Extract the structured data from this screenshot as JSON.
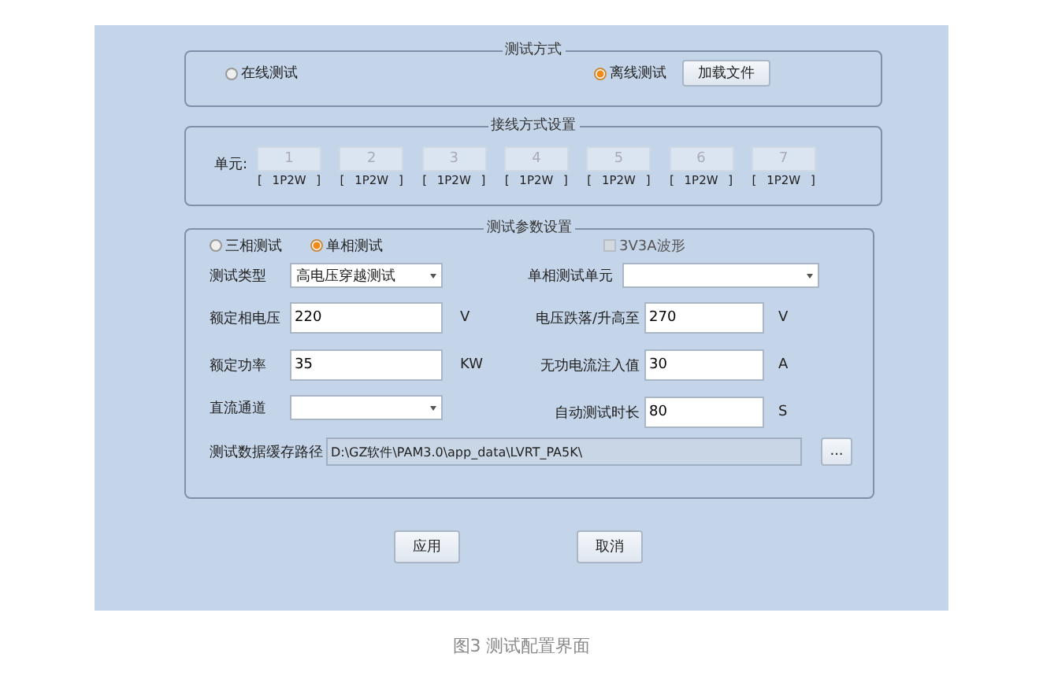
{
  "test_mode": {
    "title": "测试方式",
    "options": [
      {
        "label": "在线测试",
        "selected": false
      },
      {
        "label": "离线测试",
        "selected": true
      }
    ],
    "load_button": "加载文件"
  },
  "wiring": {
    "title": "接线方式设置",
    "label": "单元:",
    "units": [
      {
        "number": "1",
        "mode": "[ 1P2W ]",
        "disabled": true
      },
      {
        "number": "2",
        "mode": "[ 1P2W ]",
        "disabled": true
      },
      {
        "number": "3",
        "mode": "[ 1P2W ]",
        "disabled": true
      },
      {
        "number": "4",
        "mode": "[ 1P2W ]",
        "disabled": true
      },
      {
        "number": "5",
        "mode": "[ 1P2W ]",
        "disabled": true
      },
      {
        "number": "6",
        "mode": "[ 1P2W ]",
        "disabled": true
      },
      {
        "number": "7",
        "mode": "[ 1P2W ]",
        "disabled": true
      }
    ]
  },
  "params": {
    "title": "测试参数设置",
    "phase_options": [
      {
        "label": "三相测试",
        "selected": false
      },
      {
        "label": "单相测试",
        "selected": true
      }
    ],
    "waveform_checkbox": {
      "label": "3V3A波形",
      "checked": false,
      "disabled": true
    },
    "rows": [
      {
        "left": {
          "label": "测试类型",
          "kind": "combo",
          "value": "高电压穿越测试"
        },
        "right": {
          "label": "单相测试单元",
          "kind": "combo"
        }
      },
      {
        "left": {
          "label": "额定相电压",
          "kind": "text",
          "value": "220",
          "unit": "V"
        },
        "right": {
          "label": "电压跌落/升高至",
          "kind": "text",
          "value": "270",
          "unit": "V"
        }
      },
      {
        "left": {
          "label": "额定功率",
          "kind": "text",
          "value": "35",
          "unit": "KW"
        },
        "right": {
          "label": "无功电流注入值",
          "kind": "text",
          "value": "30",
          "unit": "A"
        }
      },
      {
        "left": {
          "label": "直流通道",
          "kind": "combo"
        },
        "right": {
          "label": "自动测试时长",
          "kind": "text",
          "value": "80",
          "unit": "S"
        }
      }
    ],
    "path": {
      "label": "测试数据缓存路径",
      "value": "D:\\GZ软件\\PAM3.0\\app_data\\LVRT_PA5K\\"
    },
    "browse_button": "..."
  },
  "buttons": [
    "应用",
    "取消"
  ],
  "caption": "图3 测试配置界面"
}
